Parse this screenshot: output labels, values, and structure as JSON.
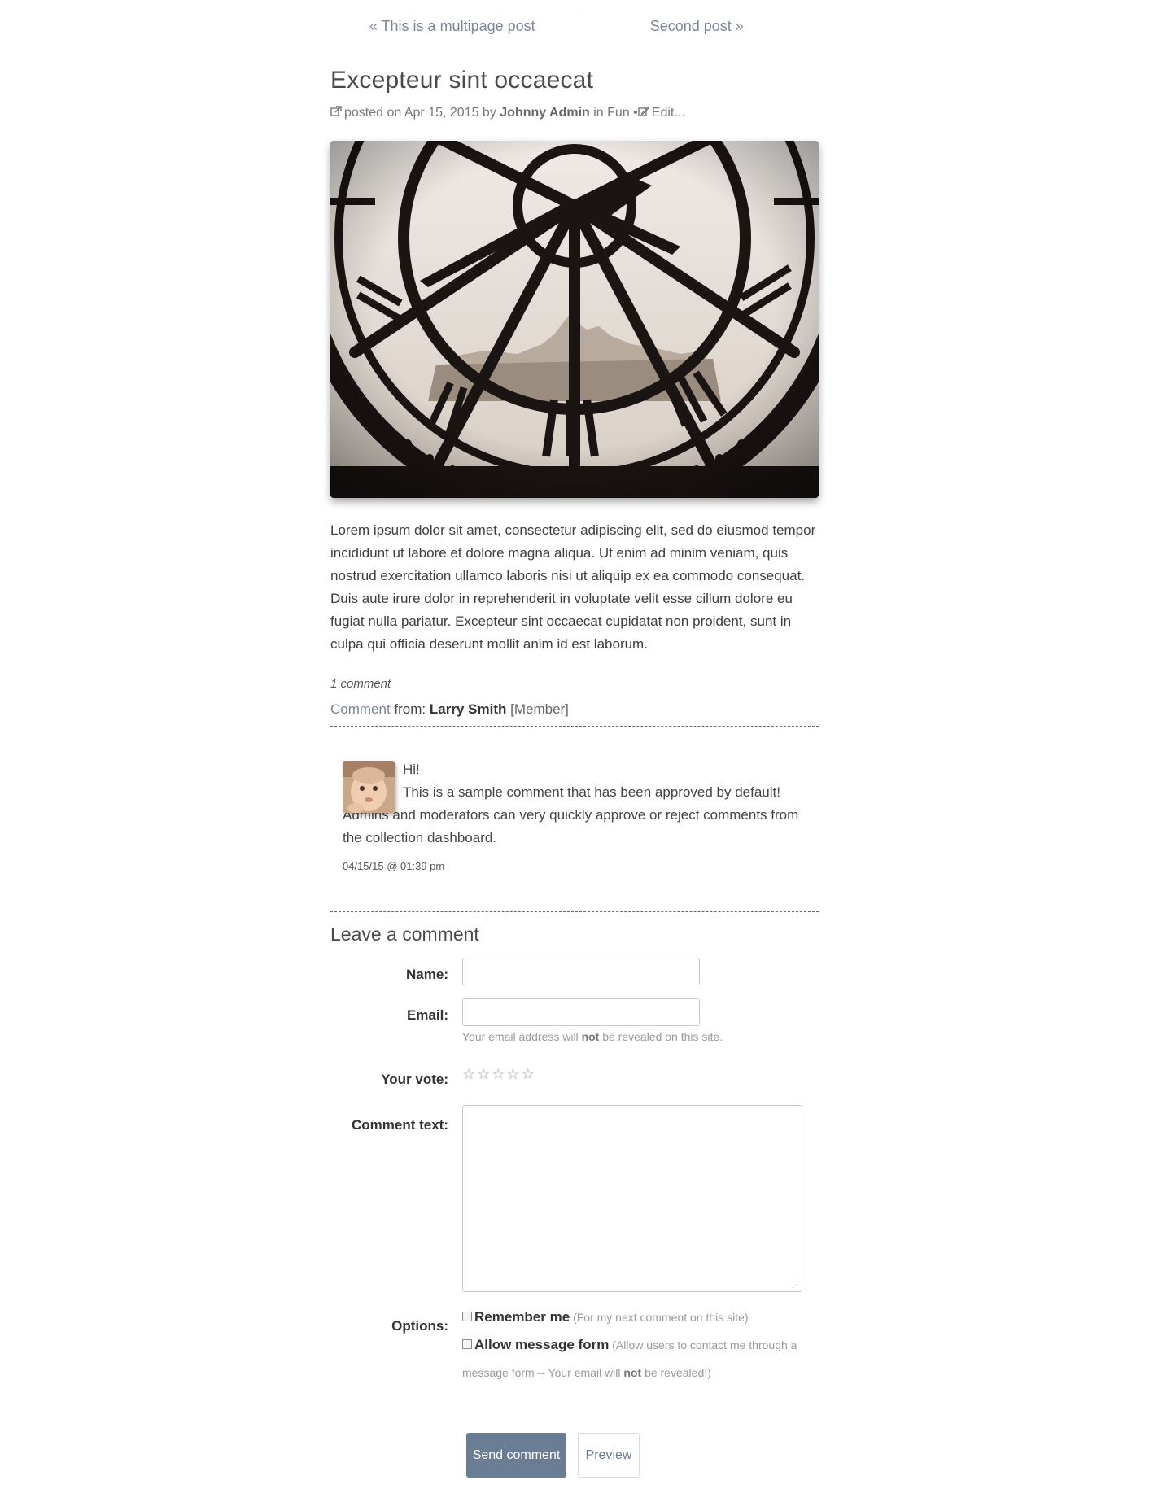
{
  "pager": {
    "prev_label": "« This is a multipage post",
    "next_label": "Second post »"
  },
  "post": {
    "title": "Excepteur sint occaecat",
    "meta": {
      "posted_on": "posted on Apr 15, 2015 by",
      "author": "Johnny Admin",
      "in_label": "in",
      "category": "Fun",
      "separator": "•",
      "edit_label": "Edit..."
    },
    "body": "Lorem ipsum dolor sit amet, consectetur adipiscing elit, sed do eiusmod tempor incididunt ut labore et dolore magna aliqua. Ut enim ad minim veniam, quis nostrud exercitation ullamco laboris nisi ut aliquip ex ea commodo consequat. Duis aute irure dolor in reprehenderit in voluptate velit esse cillum dolore eu fugiat nulla pariatur. Excepteur sint occaecat cupidatat non proident, sunt in culpa qui officia deserunt mollit anim id est laborum."
  },
  "comments": {
    "count_label": "1 comment",
    "from_label": "Comment",
    "from_text": "from:",
    "author": "Larry Smith",
    "role": "[Member]",
    "first_line": "Hi!",
    "text": "This is a sample comment that has been approved by default! Admins and moderators can very quickly approve or reject comments from the collection dashboard.",
    "date": "04/15/15 @ 01:39 pm"
  },
  "form": {
    "heading": "Leave a comment",
    "name_label": "Name:",
    "email_label": "Email:",
    "email_note_pre": "Your email address will",
    "email_note_bold": "not",
    "email_note_post": "be revealed on this site.",
    "vote_label": "Your vote:",
    "stars": [
      "☆",
      "☆",
      "☆",
      "☆",
      "☆"
    ],
    "comment_label": "Comment text:",
    "options_label": "Options:",
    "remember_label": "Remember me",
    "remember_note": "(For my next comment on this site)",
    "allow_label": "Allow message form",
    "allow_note_pre": "(Allow users to contact me through a message form -- Your email will",
    "allow_note_bold": "not",
    "allow_note_post": "be revealed!)",
    "send_label": "Send comment",
    "preview_label": "Preview"
  },
  "colors": {
    "accent": "#6b7c95",
    "link": "#7a8597"
  }
}
